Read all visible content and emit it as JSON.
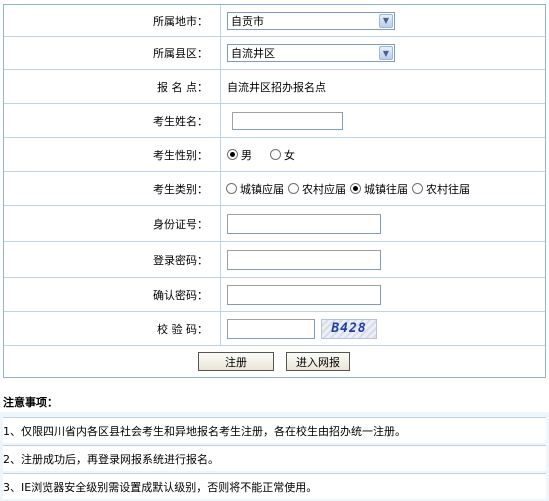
{
  "form": {
    "city": {
      "label": "所属地市：",
      "value": "自贡市"
    },
    "county": {
      "label": "所属县区：",
      "value": "自流井区"
    },
    "site": {
      "label": "报 名 点：",
      "value": "自流井区招办报名点"
    },
    "name": {
      "label": "考生姓名："
    },
    "gender": {
      "label": "考生性别：",
      "options": [
        "男",
        "女"
      ],
      "selected": "男"
    },
    "category": {
      "label": "考生类别：",
      "options": [
        "城镇应届",
        "农村应届",
        "城镇往届",
        "农村往届"
      ],
      "selected": "城镇往届"
    },
    "id_number": {
      "label": "身份证号："
    },
    "password": {
      "label": "登录密码："
    },
    "confirm": {
      "label": "确认密码："
    },
    "captcha": {
      "label": "校 验 码：",
      "image_text": "B428"
    },
    "register_button": "注册",
    "enter_button": "进入网报"
  },
  "notes": {
    "heading": "注意事项：",
    "items": [
      "1、仅限四川省内各区县社会考生和异地报名考生注册，各在校生由招办统一注册。",
      "2、注册成功后，再登录网报系统进行报名。",
      "3、IE浏览器安全级别需设置成默认级别，否则将不能正常使用。"
    ]
  }
}
